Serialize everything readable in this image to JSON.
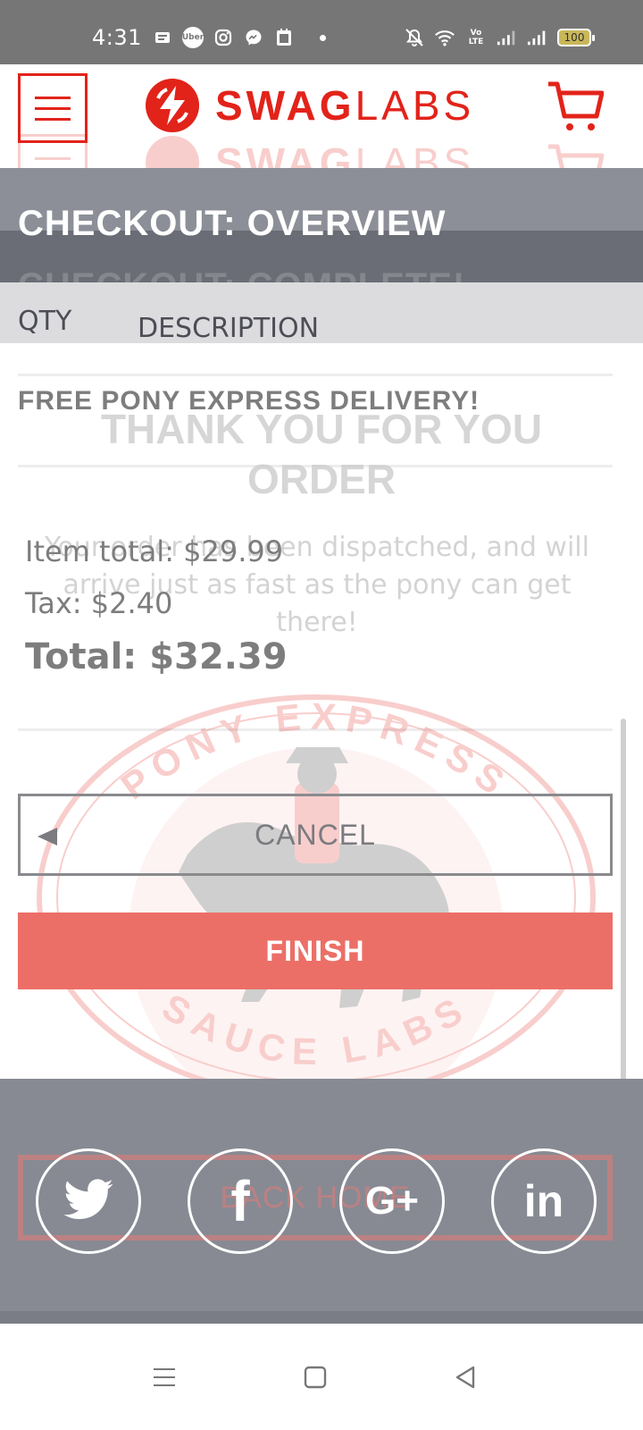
{
  "status_bar": {
    "time": "4:31",
    "left_icons": [
      "sim-status-icon",
      "uber-icon",
      "instagram-icon",
      "messenger-icon",
      "calendar-icon"
    ],
    "right_icons": [
      "mute-icon",
      "wifi-icon",
      "volte-icon",
      "signal-icon",
      "signal-icon"
    ],
    "uber_label": "Uber",
    "volte_label": "Vo LTE",
    "battery": "100"
  },
  "header": {
    "logo_swag": "SWAG",
    "logo_labs": "LABS"
  },
  "page": {
    "title": "CHECKOUT: OVERVIEW",
    "ghost_title": "CHECKOUT: COMPLETE!"
  },
  "columns": {
    "qty": "QTY",
    "description": "DESCRIPTION"
  },
  "summary": {
    "shipping": "FREE PONY EXPRESS DELIVERY!",
    "item_total": "Item total: $29.99",
    "tax": "Tax: $2.40",
    "total": "Total: $32.39"
  },
  "ghost_complete": {
    "thank_you": "THANK YOU FOR YOU ORDER",
    "dispatch": "Your order has been dispatched, and will arrive just as fast as the pony can get there!",
    "back_home": "BACK HOME"
  },
  "watermark": {
    "top_text": "PONY EXPRESS",
    "bottom_text": "SAUCE LABS"
  },
  "buttons": {
    "cancel": "CANCEL",
    "finish": "FINISH"
  },
  "footer": {
    "social": [
      "twitter-icon",
      "facebook-icon",
      "google-plus-icon",
      "linkedin-icon"
    ],
    "facebook_glyph": "f",
    "google_glyph": "G+",
    "linkedin_glyph": "in"
  },
  "colors": {
    "brand_red": "#e2231a",
    "finish_button": "#ec6f67",
    "footer": "#878a93",
    "title_bar": "#8c8f97"
  }
}
